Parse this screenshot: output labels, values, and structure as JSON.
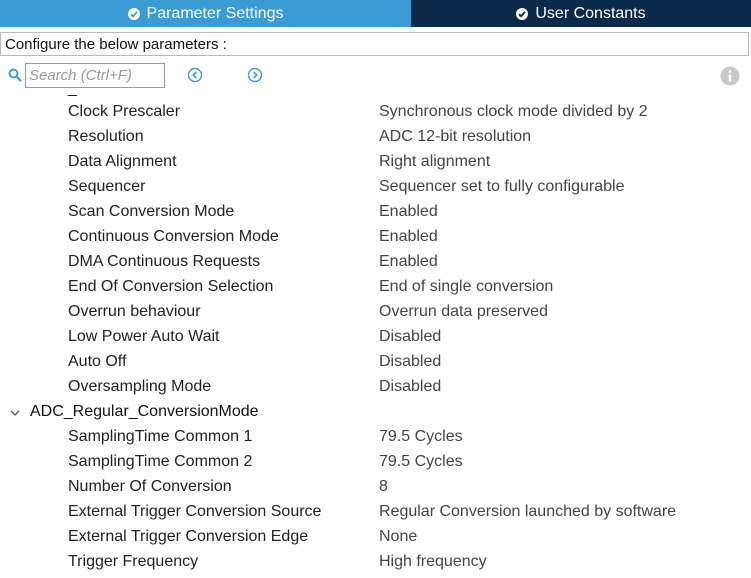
{
  "tabs": {
    "parameter_settings": "Parameter Settings",
    "user_constants": "User Constants"
  },
  "config_label": "Configure the below parameters :",
  "search": {
    "placeholder": "Search (Ctrl+F)"
  },
  "icons": {
    "tab_check": "check-circle-icon",
    "search": "search-icon",
    "previous": "circle-chevron-left-icon",
    "next": "circle-chevron-right-icon",
    "info": "info-icon",
    "group_toggle": "chevron-down-icon"
  },
  "colors": {
    "active_tab": "#3a9bd5",
    "inactive_tab": "#0b2a4a",
    "accent": "#3a9bd5"
  },
  "params_top": [
    {
      "name": "Clock Prescaler",
      "value": "Synchronous clock mode divided by 2"
    },
    {
      "name": "Resolution",
      "value": "ADC 12-bit resolution"
    },
    {
      "name": "Data Alignment",
      "value": "Right alignment"
    },
    {
      "name": "Sequencer",
      "value": "Sequencer set to fully configurable"
    },
    {
      "name": "Scan Conversion Mode",
      "value": "Enabled"
    },
    {
      "name": "Continuous Conversion Mode",
      "value": "Enabled"
    },
    {
      "name": "DMA Continuous Requests",
      "value": "Enabled"
    },
    {
      "name": "End Of Conversion Selection",
      "value": "End of single conversion"
    },
    {
      "name": "Overrun behaviour",
      "value": "Overrun data preserved"
    },
    {
      "name": "Low Power Auto Wait",
      "value": "Disabled"
    },
    {
      "name": "Auto Off",
      "value": "Disabled"
    },
    {
      "name": "Oversampling Mode",
      "value": "Disabled"
    }
  ],
  "group_regular": {
    "label": "ADC_Regular_ConversionMode",
    "params": [
      {
        "name": "SamplingTime Common 1",
        "value": "79.5 Cycles"
      },
      {
        "name": "SamplingTime Common 2",
        "value": "79.5 Cycles"
      },
      {
        "name": "Number Of Conversion",
        "value": "8"
      },
      {
        "name": "External Trigger Conversion Source",
        "value": "Regular Conversion launched by software"
      },
      {
        "name": "External Trigger Conversion Edge",
        "value": "None"
      },
      {
        "name": "Trigger Frequency",
        "value": "High frequency"
      }
    ]
  }
}
